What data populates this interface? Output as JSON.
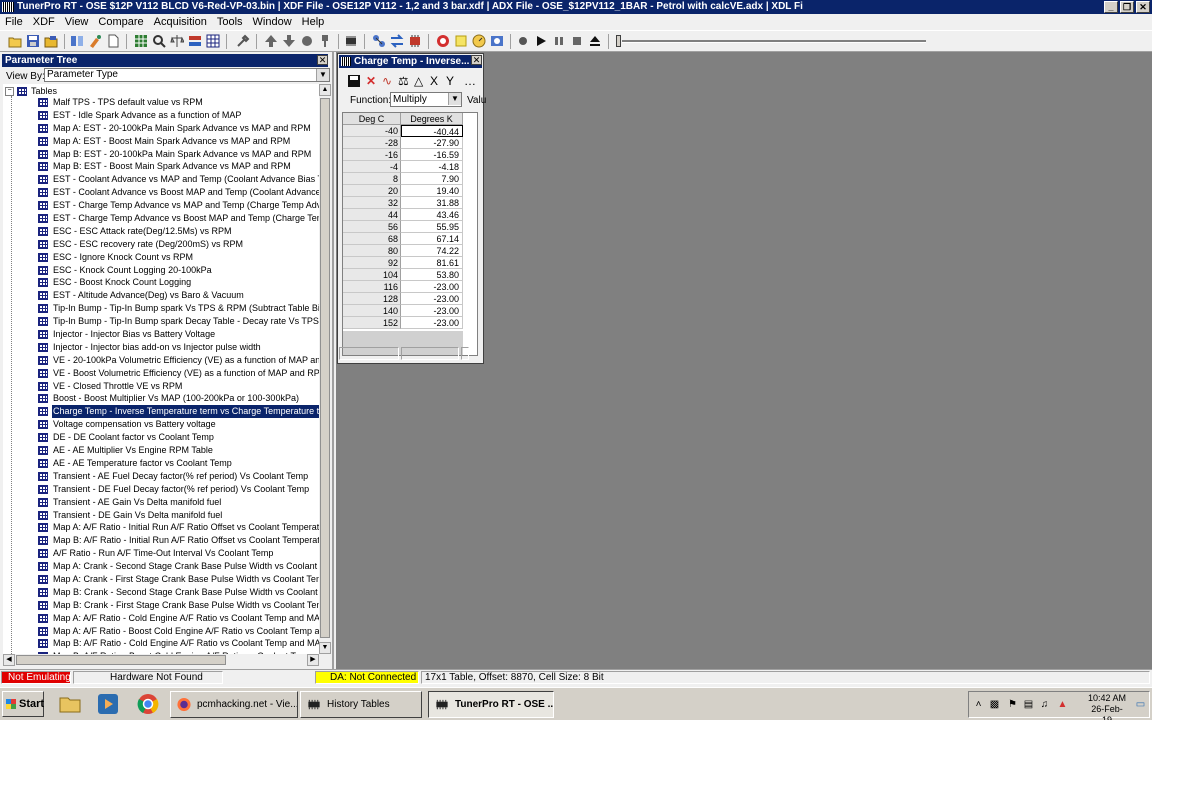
{
  "window": {
    "title": "TunerPro RT - OSE $12P V112 BLCD V6-Red-VP-03.bin | XDF File - OSE12P V112 - 1,2 and 3 bar.xdf | ADX File - OSE_$12PV112_1BAR - Petrol with calcVE.adx | XDL Fi"
  },
  "menu": [
    "File",
    "XDF",
    "View",
    "Compare",
    "Acquisition",
    "Tools",
    "Window",
    "Help"
  ],
  "tree_panel": {
    "title": "Parameter Tree",
    "view_by_label": "View By:",
    "view_by_value": "Parameter Type",
    "root_label": "Tables",
    "selected_index": 24,
    "items": [
      "Malf TPS - TPS default value vs RPM",
      "EST - Idle Spark Advance as a function of MAP",
      "Map A: EST - 20-100kPa Main Spark Advance vs MAP and RPM",
      "Map A: EST - Boost Main Spark Advance vs MAP and RPM",
      "Map B: EST - 20-100kPa Main Spark Advance vs MAP and RPM",
      "Map B: EST - Boost Main Spark Advance vs MAP and RPM",
      "EST - Coolant Advance vs MAP and Temp (Coolant Advance Bias Term",
      "EST - Coolant Advance vs Boost MAP and Temp (Coolant Advance Bia",
      "EST - Charge Temp Advance vs MAP and Temp (Charge Temp Advanc",
      "EST - Charge Temp Advance vs Boost MAP and Temp (Charge Temp A",
      "ESC - ESC Attack rate(Deg/12.5Ms) vs RPM",
      "ESC - ESC recovery rate (Deg/200mS) vs RPM",
      "ESC - Ignore Knock Count vs RPM",
      "ESC - Knock Count Logging 20-100kPa",
      "ESC - Boost Knock Count Logging",
      "EST - Altitude Advance(Deg) vs Baro & Vacuum",
      "Tip-In Bump - Tip-In Bump spark Vs TPS & RPM  (Subtract Table Bias)",
      "Tip-In Bump - Tip-In Bump spark Decay Table - Decay rate Vs TPS",
      "Injector - Injector Bias vs Battery Voltage",
      "Injector - Injector bias add-on vs Injector pulse width",
      "VE - 20-100kPa Volumetric Efficiency (VE) as a function of MAP and RP",
      "VE - Boost Volumetric Efficiency (VE) as a function of MAP and RPM",
      "VE - Closed Throttle VE vs RPM",
      "Boost - Boost Multiplier Vs MAP (100-200kPa or 100-300kPa)",
      "Charge Temp - Inverse Temperature term vs Charge Temperature ter",
      "Voltage compensation vs Battery voltage",
      "DE - DE Coolant factor vs Coolant Temp",
      "AE - AE Multiplier Vs Engine RPM Table",
      "AE - AE Temperature factor vs Coolant Temp",
      "Transient - AE Fuel Decay factor(% ref period)  Vs Coolant Temp",
      "Transient - DE Fuel Decay factor(% ref period)  Vs Coolant Temp",
      "Transient - AE Gain Vs Delta manifold fuel",
      "Transient - DE Gain Vs Delta manifold fuel",
      "Map A: A/F Ratio - Initial Run A/F Ratio Offset vs Coolant Temperatur",
      "Map B: A/F Ratio - Initial Run A/F Ratio Offset vs Coolant Temperatur",
      "A/F Ratio - Run A/F Time-Out Interval Vs Coolant Temp",
      "Map A: Crank - Second Stage Crank Base Pulse Width vs Coolant Tem",
      "Map A: Crank - First Stage Crank Base Pulse Width vs Coolant Temp",
      "Map B: Crank - Second Stage Crank Base Pulse Width vs Coolant Tem",
      "Map B: Crank - First Stage Crank Base Pulse Width vs Coolant Temp",
      "Map A: A/F Ratio - Cold Engine A/F Ratio vs Coolant Temp and MAP",
      "Map A: A/F Ratio - Boost Cold Engine A/F Ratio vs Coolant Temp and",
      "Map B: A/F Ratio - Cold Engine A/F Ratio vs Coolant Temp and MAP",
      "Map B: A/F Ratio - Boost Cold Engine A/F Ratio vs Coolant Temp and"
    ]
  },
  "table_window": {
    "title": "Charge Temp - Inverse...",
    "function_label": "Function:",
    "function_value": "Multiply",
    "value_label": "Valu",
    "col_x": "Deg C",
    "col_y": "Degrees K",
    "rows": [
      [
        "-40",
        "-40.44"
      ],
      [
        "-28",
        "-27.90"
      ],
      [
        "-16",
        "-16.59"
      ],
      [
        "-4",
        "-4.18"
      ],
      [
        "8",
        "7.90"
      ],
      [
        "20",
        "19.40"
      ],
      [
        "32",
        "31.88"
      ],
      [
        "44",
        "43.46"
      ],
      [
        "56",
        "55.95"
      ],
      [
        "68",
        "67.14"
      ],
      [
        "80",
        "74.22"
      ],
      [
        "92",
        "81.61"
      ],
      [
        "104",
        "53.80"
      ],
      [
        "116",
        "-23.00"
      ],
      [
        "128",
        "-23.00"
      ],
      [
        "140",
        "-23.00"
      ],
      [
        "152",
        "-23.00"
      ]
    ]
  },
  "status": {
    "emulation": "Not Emulating",
    "hardware": "Hardware Not Found",
    "da": "DA: Not Connected",
    "table_info": "17x1 Table, Offset: 8870,  Cell Size: 8 Bit"
  },
  "colors": {
    "title_bar": "#0a246a",
    "not_emulating": "#e00000",
    "da_yellow": "#ffff00",
    "mdi_bg": "#808080"
  },
  "taskbar": {
    "start": "Start",
    "buttons": [
      "pcmhacking.net - Vie...",
      "History Tables",
      "TunerPro RT - OSE ..."
    ],
    "time": "10:42 AM",
    "date": "26-Feb-19"
  }
}
